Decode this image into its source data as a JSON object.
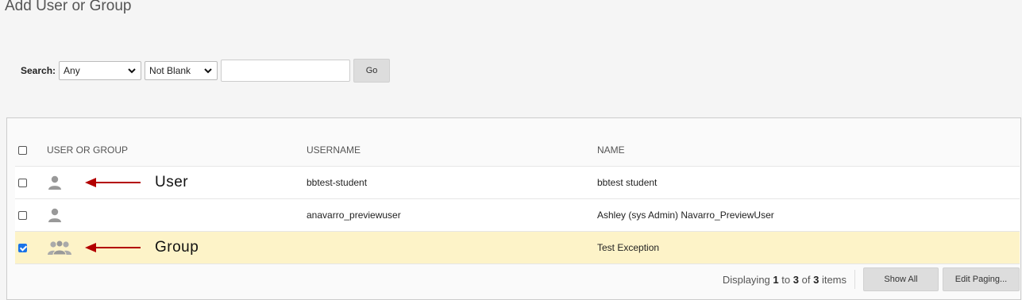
{
  "page": {
    "title": "Add User or Group"
  },
  "search": {
    "label": "Search:",
    "field_select": "Any",
    "condition_select": "Not Blank",
    "query_value": "",
    "go_label": "Go"
  },
  "table": {
    "columns": {
      "user_or_group": "USER OR GROUP",
      "username": "USERNAME",
      "name": "NAME"
    },
    "rows": [
      {
        "type_icon": "user-icon",
        "username": "bbtest-student",
        "name": "bbtest student",
        "checked": false
      },
      {
        "type_icon": "user-icon",
        "username": "anavarro_previewuser",
        "name": "Ashley (sys Admin) Navarro_PreviewUser",
        "checked": false
      },
      {
        "type_icon": "group-icon",
        "username": "",
        "name": "Test Exception",
        "checked": true
      }
    ]
  },
  "annotations": {
    "user_label": "User",
    "group_label": "Group",
    "arrow_color": "#b30000"
  },
  "footer": {
    "displaying_prefix": "Displaying",
    "range_start": "1",
    "to_word": "to",
    "range_end": "3",
    "of_word": "of",
    "total": "3",
    "items_word": "items",
    "show_all_label": "Show All",
    "edit_paging_label": "Edit Paging..."
  },
  "colors": {
    "selected_row": "#fdf3c8",
    "checkbox_checked": "#1a73e8"
  }
}
